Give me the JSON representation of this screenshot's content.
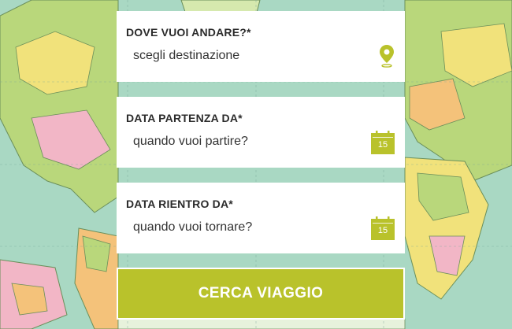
{
  "form": {
    "destination": {
      "label": "DOVE VUOI ANDARE?*",
      "placeholder": "scegli destinazione",
      "icon": "map-pin-icon"
    },
    "departure": {
      "label": "DATA PARTENZA DA*",
      "placeholder": "quando vuoi partire?",
      "icon": "calendar-icon",
      "icon_day": "15"
    },
    "return": {
      "label": "DATA RIENTRO DA*",
      "placeholder": "quando vuoi tornare?",
      "icon": "calendar-icon",
      "icon_day": "15"
    },
    "submit_label": "CERCA VIAGGIO"
  },
  "colors": {
    "accent": "#b9c22b",
    "label_text": "#2b2b2b",
    "map_ocean": "#a9d8c3",
    "map_land_green": "#b9d77b",
    "map_land_yellow": "#f1e27b",
    "map_land_pink": "#f2b6c6",
    "map_land_orange": "#f4c27a"
  }
}
